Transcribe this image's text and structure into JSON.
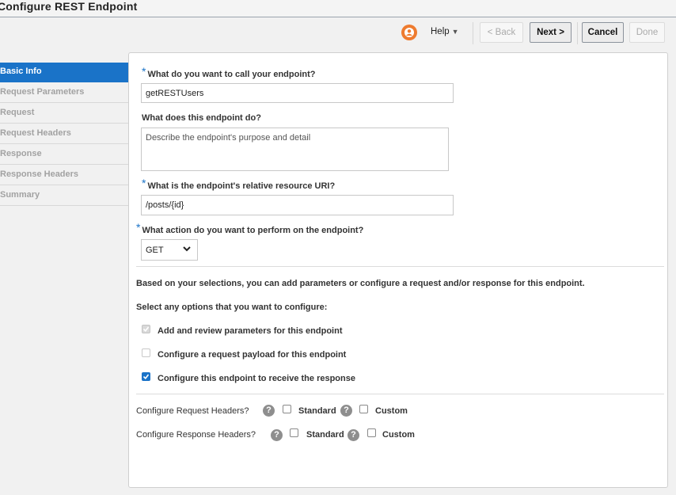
{
  "window": {
    "title": "Configure REST Endpoint"
  },
  "toolbar": {
    "help_label": "Help",
    "back_label": "< Back",
    "next_label": "Next >",
    "cancel_label": "Cancel",
    "done_label": "Done"
  },
  "sidebar": {
    "items": [
      {
        "label": "Basic Info",
        "active": true
      },
      {
        "label": "Request Parameters"
      },
      {
        "label": "Request"
      },
      {
        "label": "Request Headers"
      },
      {
        "label": "Response"
      },
      {
        "label": "Response Headers"
      },
      {
        "label": "Summary"
      }
    ]
  },
  "form": {
    "name_label": "What do you want to call your endpoint?",
    "name_value": "getRESTUsers",
    "desc_label": "What does this endpoint do?",
    "desc_placeholder": "Describe the endpoint's purpose and detail",
    "uri_label": "What is the endpoint's relative resource URI?",
    "uri_value": "/posts/{id}",
    "action_label": "What action do you want to perform on the endpoint?",
    "action_value": "GET",
    "info_text": "Based on your selections, you can add parameters or configure a request and/or response for this endpoint.",
    "options_heading": "Select any options that you want to configure:",
    "opt_params": "Add and review parameters for this endpoint",
    "opt_request": "Configure a request payload for this endpoint",
    "opt_response": "Configure this endpoint to receive the response",
    "req_headers_label": "Configure Request Headers?",
    "resp_headers_label": "Configure Response Headers?",
    "standard_label": "Standard",
    "custom_label": "Custom",
    "help_glyph": "?"
  },
  "colors": {
    "accent": "#1a73c8",
    "avatar": "#ee7b2f"
  }
}
